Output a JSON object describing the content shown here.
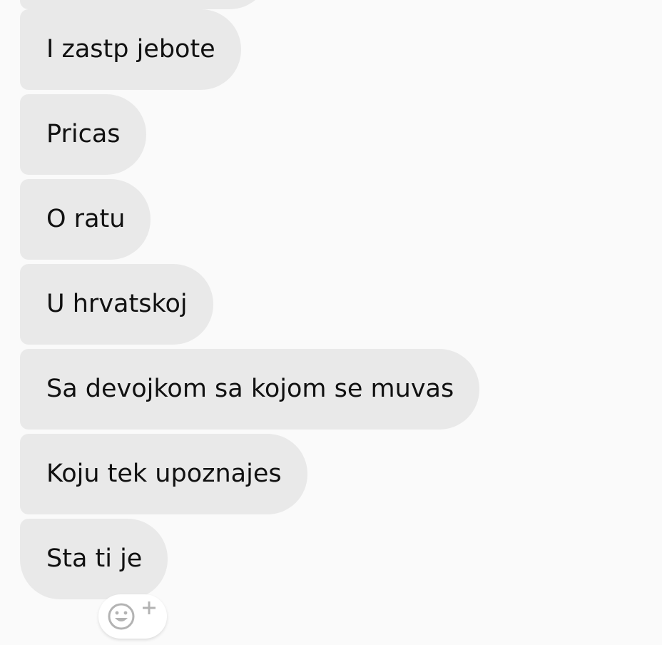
{
  "messages": [
    {
      "text": "I zastp jebote"
    },
    {
      "text": "Pricas"
    },
    {
      "text": "O ratu"
    },
    {
      "text": "U hrvatskoj"
    },
    {
      "text": "Sa devojkom sa kojom se muvas"
    },
    {
      "text": "Koju tek upoznajes"
    },
    {
      "text": "Sta ti je"
    }
  ],
  "reaction": {
    "icon": "add-reaction-icon"
  },
  "colors": {
    "background": "#fafafa",
    "bubble": "#e9e9e9",
    "text": "#111111",
    "icon": "#b3b3b3"
  }
}
